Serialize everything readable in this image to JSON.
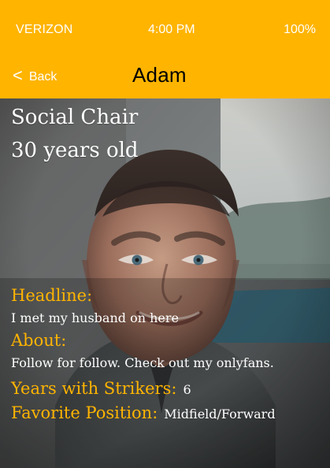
{
  "status_bar": {
    "carrier": "VERIZON",
    "time": "4:00 PM",
    "battery": "100%"
  },
  "nav": {
    "back_label": "Back",
    "title": "Adam"
  },
  "profile": {
    "role": "Social Chair",
    "age_text": "30 years old",
    "headline_label": "Headline:",
    "headline_value": "I met my husband on here",
    "about_label": "About:",
    "about_value": "Follow for follow. Check out my onlyfans.",
    "years_label": "Years with Strikers:",
    "years_value": "6",
    "position_label": "Favorite Position:",
    "position_value": "Midfield/Forward"
  },
  "colors": {
    "accent": "#FFB400",
    "text_on_accent": "#FFFFFF",
    "nav_title": "#000000"
  },
  "icons": {
    "back": "chevron-left-icon"
  }
}
